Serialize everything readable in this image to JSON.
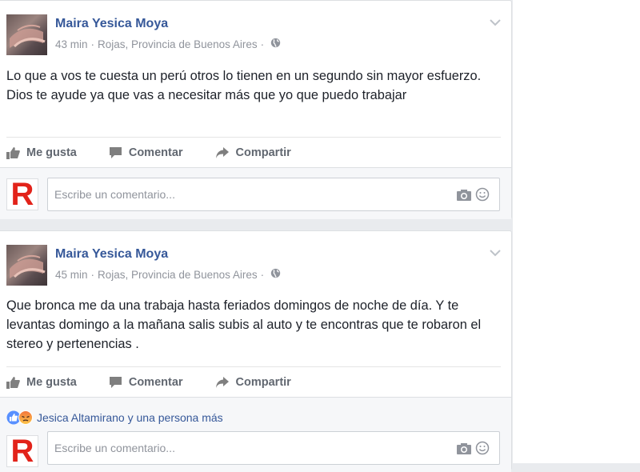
{
  "posts": [
    {
      "author": "Maira Yesica Moya",
      "time": "43 min",
      "location": "Rojas, Provincia de Buenos Aires",
      "text": "Lo que a vos te cuesta un perú otros lo tienen en un segundo sin mayor esfuerzo. Dios te ayude ya que vas a necesitar más que yo que puedo trabajar",
      "like_label": "Me gusta",
      "comment_label": "Comentar",
      "share_label": "Compartir",
      "comment_placeholder": "Escribe un comentario..."
    },
    {
      "author": "Maira Yesica Moya",
      "time": "45 min",
      "location": "Rojas, Provincia de Buenos Aires",
      "text": "Que bronca me da una trabaja hasta feriados domingos de noche de día. Y te levantas domingo a la mañana salis subis al auto y te encontras que te robaron el stereo y pertenencias .",
      "like_label": "Me gusta",
      "comment_label": "Comentar",
      "share_label": "Compartir",
      "reactions_text": "Jesica Altamirano y una persona más",
      "comment_placeholder": "Escribe un comentario..."
    }
  ],
  "commenter_logo_letter": "R",
  "separator": "·",
  "colors": {
    "link": "#365899",
    "logo_red": "#e2231a",
    "like_blue": "#5890ff",
    "angry_orange": "#f3733b"
  },
  "icons": [
    "chevron-down-icon",
    "globe-icon",
    "thumbs-up-icon",
    "comment-icon",
    "share-icon",
    "camera-icon",
    "smiley-icon",
    "like-reaction-icon",
    "angry-reaction-icon"
  ]
}
